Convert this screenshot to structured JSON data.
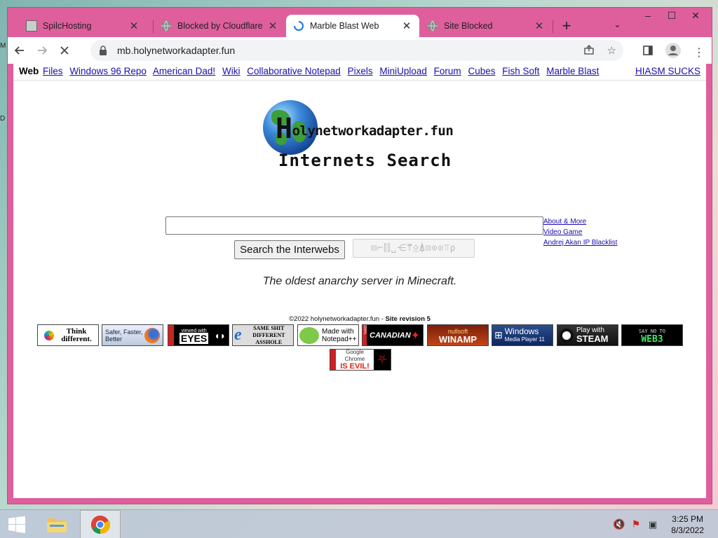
{
  "tabs": [
    {
      "title": "SpilcHosting",
      "icon": "spilc-favicon",
      "active": false
    },
    {
      "title": "Blocked by Cloudflare",
      "icon": "globe-icon",
      "active": false
    },
    {
      "title": "Marble Blast Web",
      "icon": "loading-spinner-icon",
      "active": true
    },
    {
      "title": "Site Blocked",
      "icon": "globe-icon",
      "active": false
    }
  ],
  "window_controls": {
    "minimize": "–",
    "maximize": "☐",
    "close": "✕"
  },
  "address": {
    "url": "mb.holynetworkadapter.fun"
  },
  "nav": {
    "web": "Web",
    "links": [
      "Files",
      "Windows 96 Repo",
      "American Dad!",
      "Wiki",
      "Collaborative Notepad",
      "Pixels",
      "MiniUpload",
      "Forum",
      "Cubes",
      "Fish Soft",
      "Marble Blast"
    ],
    "right_link": "HIASM SUCKS"
  },
  "logo": {
    "h": "H",
    "title_rest": "olynetworkadapter.fun",
    "subtitle": "Internets Search"
  },
  "search": {
    "value": "",
    "button": "Search the Interwebs",
    "alt_button": "⊟⌐⫿⫿␣⋲⍑⍚⍋⊡⊙⊙⫪⍴"
  },
  "side_links": [
    "About & More",
    "Video Game",
    "Andrej Akan IP Blacklist"
  ],
  "tagline": "The oldest anarchy server in Minecraft.",
  "footer": {
    "copyright": "©2022 holynetworkadapter.fun - ",
    "revision": "Site revision 5"
  },
  "badges": [
    {
      "name": "badge-think-different",
      "line1": "Think",
      "line2": "different."
    },
    {
      "name": "badge-firefox",
      "line1": "Safer, Faster,",
      "line2": "Better"
    },
    {
      "name": "badge-viewed-with-eyes",
      "line1": "viewed with",
      "line2": "EYES"
    },
    {
      "name": "badge-same-shit",
      "line1": "SAME SHIT DIFFERENT",
      "line2": "ASSHOLE"
    },
    {
      "name": "badge-notepadpp",
      "line1": "Made with",
      "line2": "Notepad++"
    },
    {
      "name": "badge-canadian",
      "line1": "100%",
      "line2": "CANADIAN"
    },
    {
      "name": "badge-winamp",
      "line1": "nullsoft",
      "line2": "WINAMP"
    },
    {
      "name": "badge-wmp",
      "line1": "Windows",
      "line2": "Media Player 11"
    },
    {
      "name": "badge-steam",
      "line1": "Play with",
      "line2": "STEAM"
    },
    {
      "name": "badge-web3",
      "line1": "SAY NO TO",
      "line2": "WEB3"
    },
    {
      "name": "badge-chrome-evil",
      "line1": "Google Chrome",
      "line2": "IS EVIL!"
    }
  ],
  "taskbar": {
    "time": "3:25 PM",
    "date": "8/3/2022"
  },
  "colors": {
    "window_frame": "#df5f9d",
    "link": "#1a0dab",
    "taskbar": "#bec8d7"
  }
}
